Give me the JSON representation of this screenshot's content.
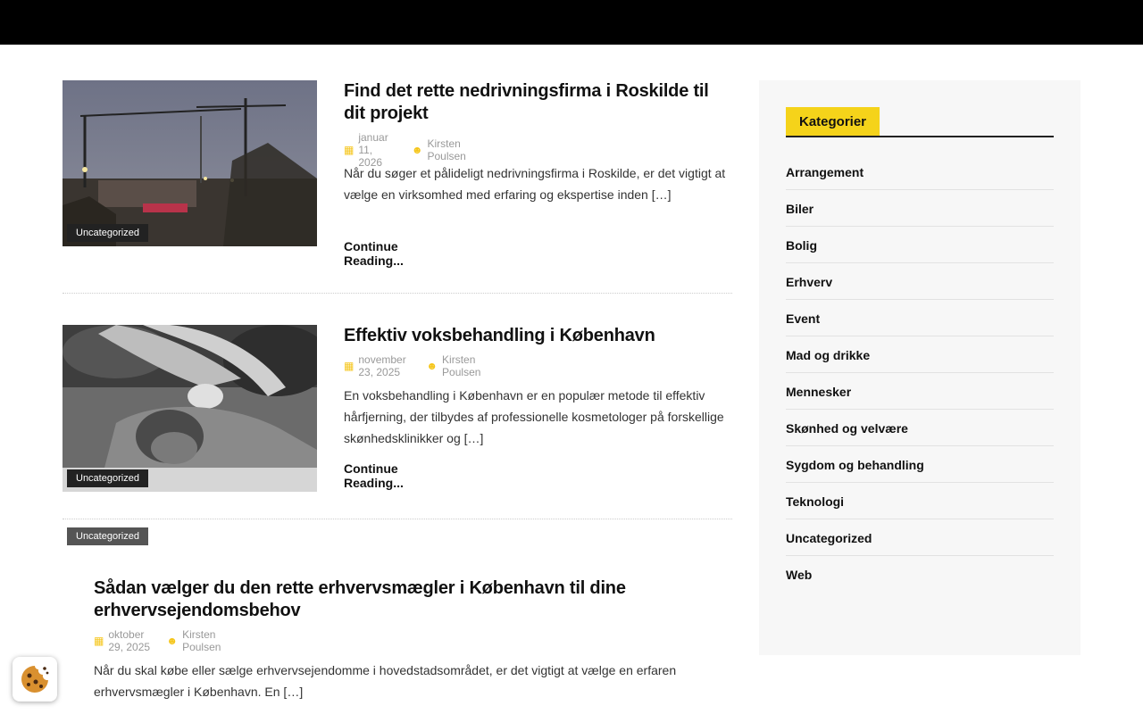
{
  "posts": [
    {
      "category": "Uncategorized",
      "title": "Find det rette nedrivningsfirma i Roskilde til dit projekt",
      "date": "januar 11, 2026",
      "author": "Kirsten Poulsen",
      "excerpt": "Når du søger et pålideligt nedrivningsfirma i Roskilde, er det vigtigt at vælge en virksomhed med erfaring og ekspertise inden […]",
      "read_more": "Continue Reading..."
    },
    {
      "category": "Uncategorized",
      "title": "Effektiv voksbehandling i København",
      "date": "november 23, 2025",
      "author": "Kirsten Poulsen",
      "excerpt": "En voksbehandling i København er en populær metode til effektiv hårfjerning, der tilbydes af professionelle kosmetologer på forskellige skønhedsklinikker og […]",
      "read_more": "Continue Reading..."
    },
    {
      "category": "Uncategorized",
      "title": "Sådan vælger du den rette erhvervsmægler i København til dine erhvervsejendomsbehov",
      "date": "oktober 29, 2025",
      "author": "Kirsten Poulsen",
      "excerpt": "Når du skal købe eller sælge erhvervsejendomme i hovedstadsområdet, er det vigtigt at vælge en erfaren erhvervsmægler i København. En […]"
    }
  ],
  "sidebar": {
    "widget_title": "Kategorier",
    "categories": [
      "Arrangement",
      "Biler",
      "Bolig",
      "Erhverv",
      "Event",
      "Mad og drikke",
      "Mennesker",
      "Skønhed og velvære",
      "Sygdom og behandling",
      "Teknologi",
      "Uncategorized",
      "Web"
    ]
  },
  "icons": {
    "date": "calendar-icon",
    "author": "user-icon",
    "cookie": "cookie-icon"
  },
  "colors": {
    "accent": "#f5d31a",
    "topbar": "#000000"
  }
}
